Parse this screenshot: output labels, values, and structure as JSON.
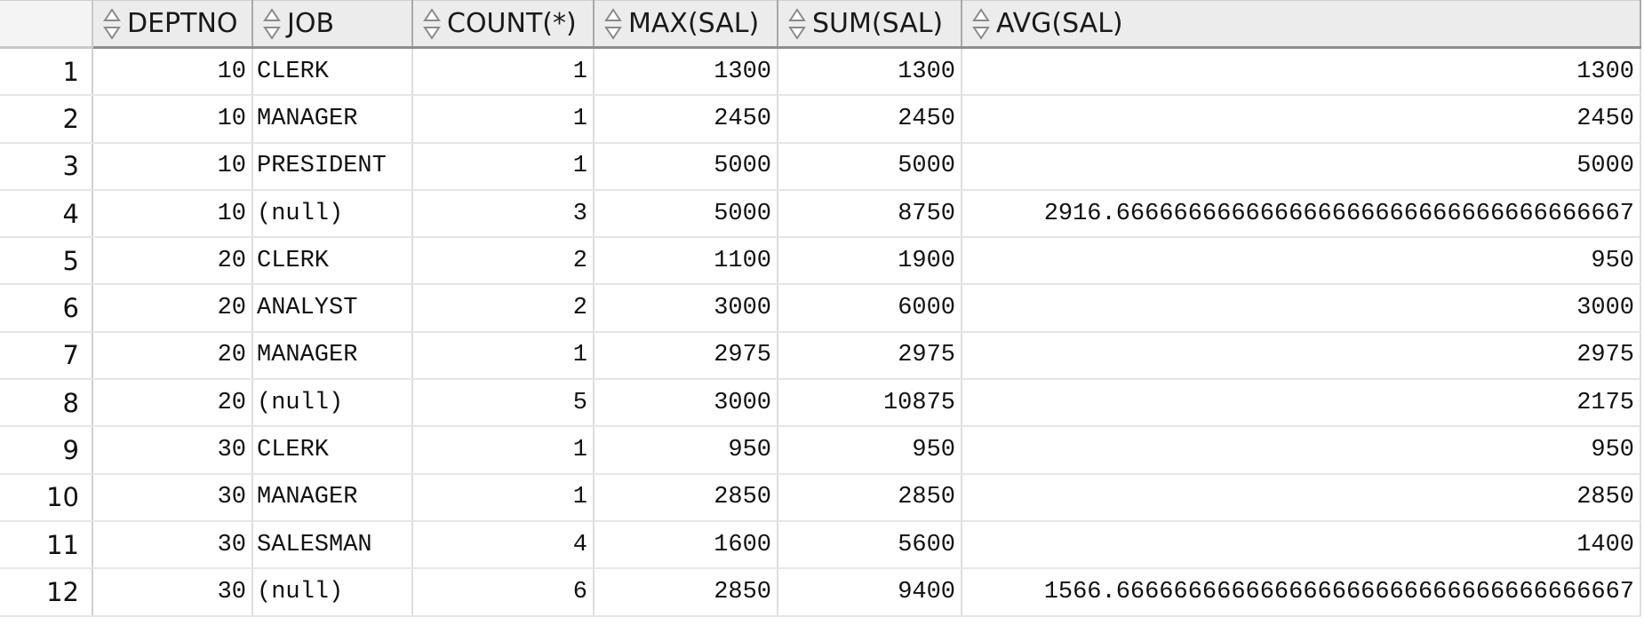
{
  "grid": {
    "columns": [
      {
        "key": "deptno",
        "label": "DEPTNO",
        "align": "right"
      },
      {
        "key": "job",
        "label": "JOB",
        "align": "left"
      },
      {
        "key": "count",
        "label": "COUNT(*)",
        "align": "right"
      },
      {
        "key": "max_sal",
        "label": "MAX(SAL)",
        "align": "right"
      },
      {
        "key": "sum_sal",
        "label": "SUM(SAL)",
        "align": "right"
      },
      {
        "key": "avg_sal",
        "label": "AVG(SAL)",
        "align": "right"
      }
    ],
    "rows": [
      {
        "n": "1",
        "cells": [
          "10",
          "CLERK",
          "1",
          "1300",
          "1300",
          "1300"
        ]
      },
      {
        "n": "2",
        "cells": [
          "10",
          "MANAGER",
          "1",
          "2450",
          "2450",
          "2450"
        ]
      },
      {
        "n": "3",
        "cells": [
          "10",
          "PRESIDENT",
          "1",
          "5000",
          "5000",
          "5000"
        ]
      },
      {
        "n": "4",
        "cells": [
          "10",
          "(null)",
          "3",
          "5000",
          "8750",
          "2916.666666666666666666666666666666666667"
        ]
      },
      {
        "n": "5",
        "cells": [
          "20",
          "CLERK",
          "2",
          "1100",
          "1900",
          "950"
        ]
      },
      {
        "n": "6",
        "cells": [
          "20",
          "ANALYST",
          "2",
          "3000",
          "6000",
          "3000"
        ]
      },
      {
        "n": "7",
        "cells": [
          "20",
          "MANAGER",
          "1",
          "2975",
          "2975",
          "2975"
        ]
      },
      {
        "n": "8",
        "cells": [
          "20",
          "(null)",
          "5",
          "3000",
          "10875",
          "2175"
        ]
      },
      {
        "n": "9",
        "cells": [
          "30",
          "CLERK",
          "1",
          "950",
          "950",
          "950"
        ]
      },
      {
        "n": "10",
        "cells": [
          "30",
          "MANAGER",
          "1",
          "2850",
          "2850",
          "2850"
        ]
      },
      {
        "n": "11",
        "cells": [
          "30",
          "SALESMAN",
          "4",
          "1600",
          "5600",
          "1400"
        ]
      },
      {
        "n": "12",
        "cells": [
          "30",
          "(null)",
          "6",
          "2850",
          "9400",
          "1566.666666666666666666666666666666666667"
        ]
      }
    ]
  },
  "icons": {
    "sort": "sort-updown-icon"
  }
}
